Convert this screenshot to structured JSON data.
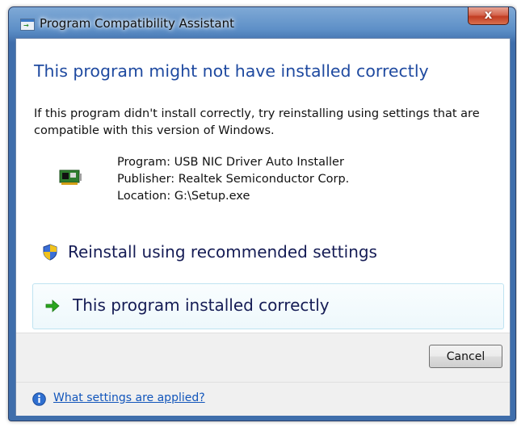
{
  "window": {
    "title": "Program Compatibility Assistant",
    "close_label": "x"
  },
  "main_instruction": "This program might not have installed correctly",
  "description": "If this program didn't install correctly, try reinstalling using settings that are compatible with this version of Windows.",
  "program_info": {
    "program": "Program: USB NIC Driver Auto Installer",
    "publisher": "Publisher: Realtek Semiconductor Corp.",
    "location": "Location: G:\\Setup.exe"
  },
  "commands": {
    "reinstall": "Reinstall using recommended settings",
    "installed_correctly": "This program installed correctly"
  },
  "buttons": {
    "cancel": "Cancel"
  },
  "footer": {
    "help_link": "What settings are applied?"
  },
  "icons": {
    "title": "app-window-icon",
    "program": "network-card-icon",
    "reinstall": "uac-shield-icon",
    "installed_correctly": "green-arrow-icon",
    "help": "info-icon"
  },
  "colors": {
    "main_instruction": "#1f4aa0",
    "command_text": "#151c55",
    "link": "#1155bb",
    "close_button": "#c23c22"
  }
}
